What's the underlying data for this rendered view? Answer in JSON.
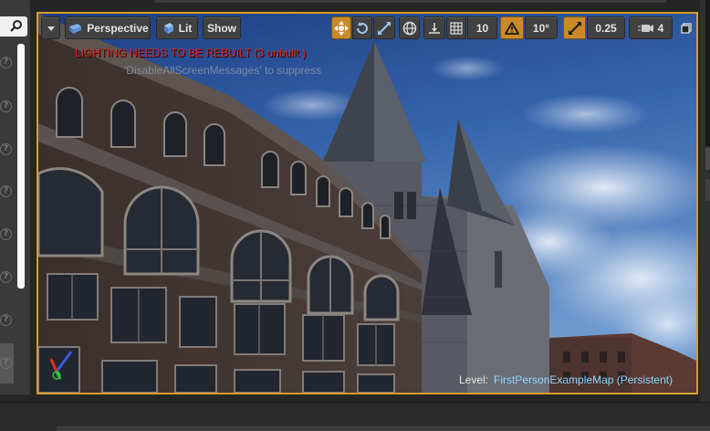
{
  "toolbar": {
    "dropdown_icon": "chevron-down-icon",
    "perspective_label": "Perspective",
    "lit_label": "Lit",
    "show_label": "Show",
    "grid_snap_value": "10",
    "rotation_snap_value": "10°",
    "scale_snap_value": "0.25",
    "camera_speed_value": "4",
    "accent_color": "#c98a27"
  },
  "viewport": {
    "lighting_warning": "LIGHTING NEEDS TO BE REBUILT (3 unbuilt )",
    "suppress_hint": "'DisableAllScreenMessages' to suppress",
    "level_label": "Level:",
    "level_name": "FirstPersonExampleMap (Persistent)",
    "border_color": "#d69d2a"
  },
  "left_panel": {
    "search_icon": "search-icon",
    "help_icon": "help-icon",
    "help_glyph": "?"
  }
}
